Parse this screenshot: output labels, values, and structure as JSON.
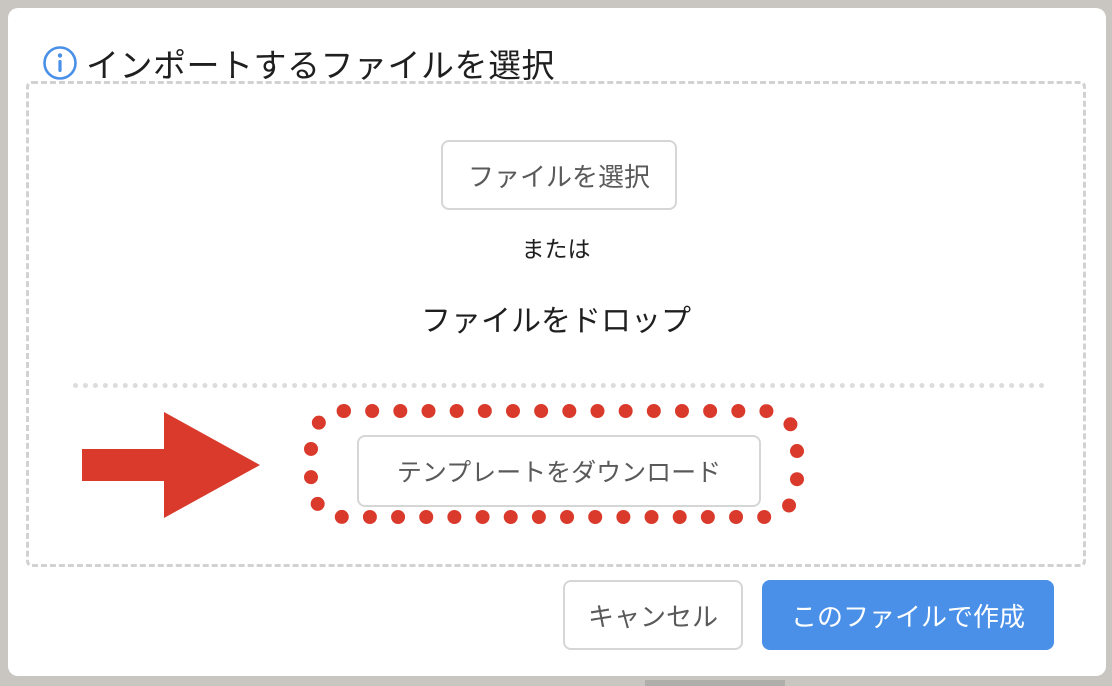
{
  "dialog": {
    "title": "インポートするファイルを選択",
    "title_icon": "info-icon"
  },
  "drop_zone": {
    "select_file_label": "ファイルを選択",
    "or_text": "または",
    "drop_text": "ファイルをドロップ",
    "template_download_label": "テンプレートをダウンロード"
  },
  "footer": {
    "cancel_label": "キャンセル",
    "create_label": "このファイルで作成"
  },
  "annotation": {
    "arrow_icon": "arrow-right-icon",
    "highlight_color": "#d93a2b"
  },
  "colors": {
    "accent": "#4a90e8",
    "info_icon": "#4a90e8"
  }
}
